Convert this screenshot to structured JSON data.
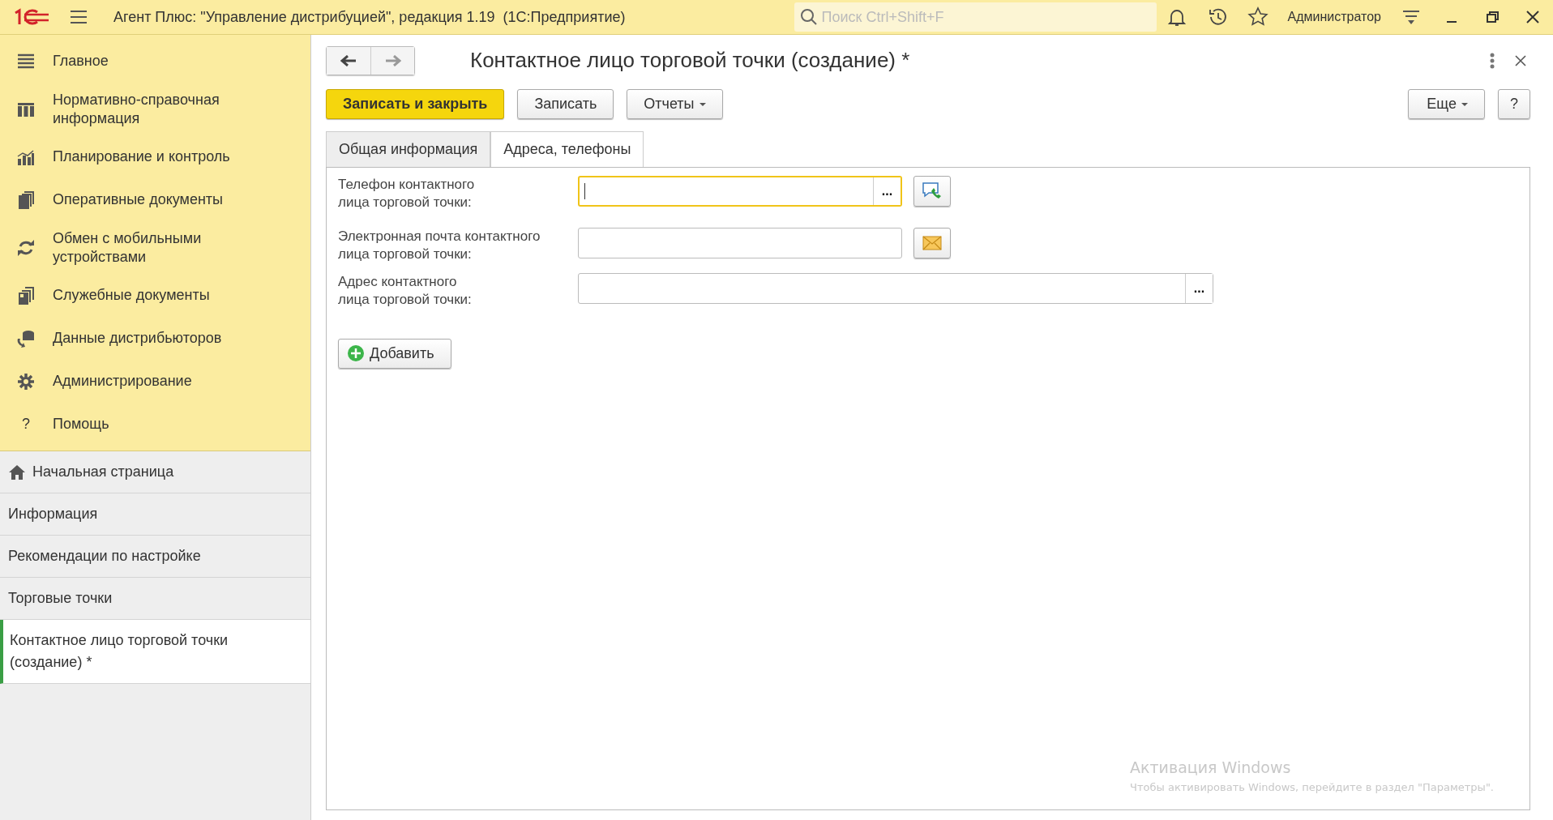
{
  "app": {
    "title": "Агент Плюс: \"Управление дистрибуцией\", редакция 1.19  (1С:Предприятие)",
    "search": {
      "placeholder": "Поиск Ctrl+Shift+F"
    },
    "user": "Администратор"
  },
  "sections": [
    {
      "label": "Главное"
    },
    {
      "label": "Нормативно-справочная информация"
    },
    {
      "label": "Планирование и контроль"
    },
    {
      "label": "Оперативные документы"
    },
    {
      "label": "Обмен с мобильными устройствами"
    },
    {
      "label": "Служебные документы"
    },
    {
      "label": "Данные дистрибьюторов"
    },
    {
      "label": "Администрирование"
    },
    {
      "label": "Помощь",
      "glyph": "?"
    }
  ],
  "open_windows": [
    {
      "label": "Начальная страница",
      "kind": "home",
      "selected": false
    },
    {
      "label": "Информация",
      "kind": "page",
      "selected": false
    },
    {
      "label": "Рекомендации по настройке",
      "kind": "page",
      "selected": false
    },
    {
      "label": "Торговые точки",
      "kind": "page",
      "selected": false
    },
    {
      "label": "Контактное лицо торговой точки (создание) *",
      "kind": "page",
      "selected": true
    }
  ],
  "form": {
    "title": "Контактное лицо торговой точки (создание) *",
    "buttons": [
      {
        "label": "Записать и закрыть",
        "kind": "primary"
      },
      {
        "label": "Записать",
        "kind": "plain"
      },
      {
        "label": "Отчеты",
        "kind": "dropdown"
      }
    ],
    "more": "Еще",
    "help": "?",
    "tabs": [
      {
        "label": "Общая информация",
        "selected": false
      },
      {
        "label": "Адреса, телефоны",
        "selected": true
      }
    ],
    "fields": [
      {
        "label": "Телефон контактного\nлица торговой точки:",
        "focused": true,
        "select_button": "...",
        "kind": "phone"
      },
      {
        "label": "Электронная почта контактного\nлица торговой точки:",
        "focused": false,
        "kind": "email"
      },
      {
        "label": "Адрес контактного\nлица торговой точки:",
        "focused": false,
        "select_button": "...",
        "kind": "address"
      }
    ],
    "add_button": "Добавить"
  },
  "os_notice": {
    "title": "Активация Windows",
    "text": "Чтобы активировать Windows, перейдите в раздел \"Параметры\"."
  }
}
